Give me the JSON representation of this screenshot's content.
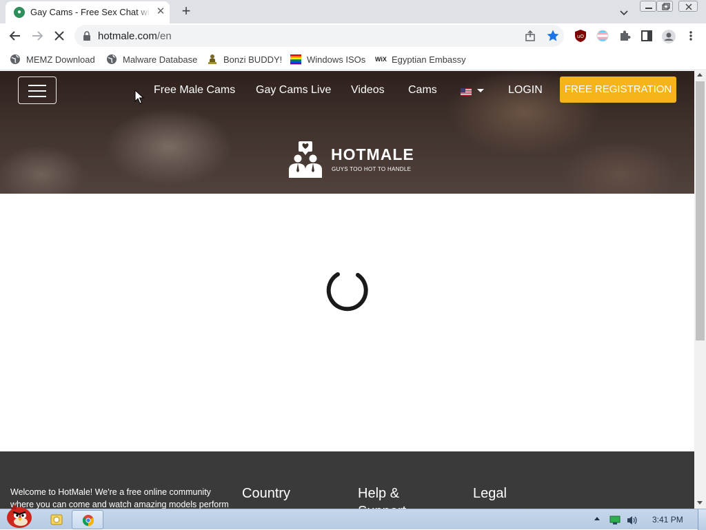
{
  "browser": {
    "tab": {
      "title": "Gay Cams - Free Sex Chat with",
      "close": "✕"
    },
    "new_tab": "+",
    "url": {
      "domain": "hotmale.com",
      "path": "/en"
    },
    "bookmarks": [
      {
        "label": "MEMZ Download",
        "icon": "globe-icon"
      },
      {
        "label": "Malware Database",
        "icon": "globe-icon"
      },
      {
        "label": "Bonzi BUDDY!",
        "icon": "bonzi-icon"
      },
      {
        "label": "Windows ISOs",
        "icon": "rainbow-flag-icon"
      },
      {
        "label": "Egyptian Embassy",
        "icon": "wix-icon"
      }
    ]
  },
  "site": {
    "nav": {
      "links": [
        "Free Male Cams",
        "Gay Cams Live",
        "Videos",
        "Cams"
      ],
      "login": "LOGIN",
      "register": "FREE REGISTRATION"
    },
    "logo": {
      "name": "HOTMALE",
      "tagline": "GUYS TOO HOT TO HANDLE"
    },
    "footer": {
      "blurb": "Welcome to HotMale! We're a free online community where you can come and watch amazing models perform",
      "headings": [
        "Country",
        "Help & Support",
        "Legal"
      ]
    },
    "colors": {
      "register_bg": "#f6b31a",
      "footer_bg": "#3a3a3a",
      "accent_star": "#1a73e8"
    }
  },
  "taskbar": {
    "clock": "3:41 PM"
  }
}
